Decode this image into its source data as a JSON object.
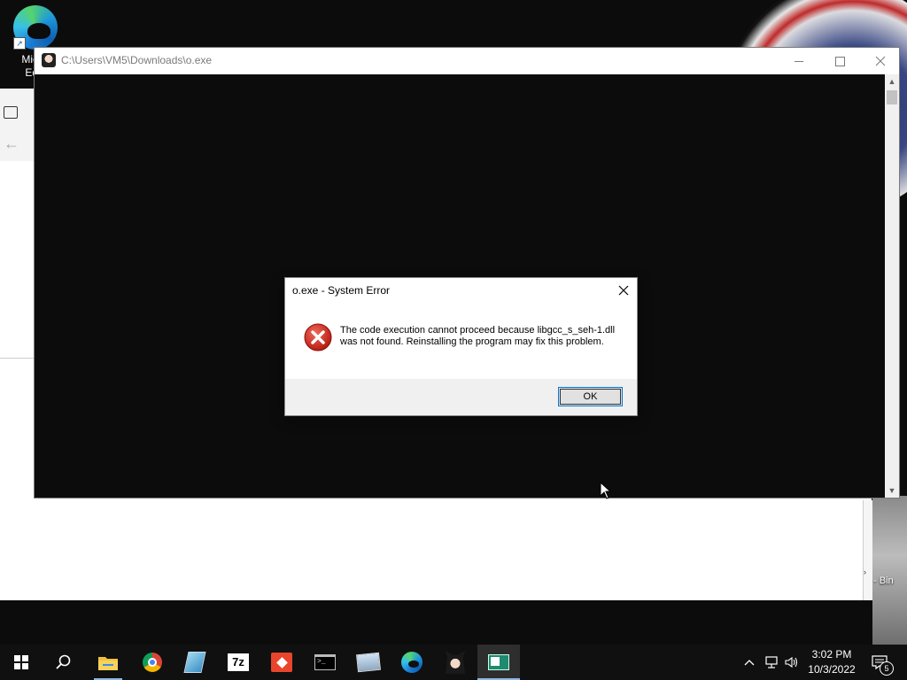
{
  "desktop": {
    "edge_icon_label": "Micro\nEdg",
    "recycle_label": "- Bin"
  },
  "console_window": {
    "title": "C:\\Users\\VM5\\Downloads\\o.exe",
    "minimize_label": "—",
    "maximize_label": "☐",
    "close_label": "✕"
  },
  "dialog": {
    "title": "o.exe - System Error",
    "message": "The code execution cannot proceed because libgcc_s_seh-1.dll was not found. Reinstalling the program may fix this problem.",
    "ok_label": "OK"
  },
  "taskbar": {
    "apps": [
      {
        "name": "start",
        "icon": "windows-icon"
      },
      {
        "name": "search",
        "icon": "search-icon"
      },
      {
        "name": "file-explorer",
        "icon": "folder-icon"
      },
      {
        "name": "chrome",
        "icon": "chrome-icon"
      },
      {
        "name": "notepad-like",
        "icon": "notebook-icon"
      },
      {
        "name": "7zip",
        "icon": "7z-icon",
        "text": "7z"
      },
      {
        "name": "git",
        "icon": "git-icon"
      },
      {
        "name": "terminal",
        "icon": "cmd-icon"
      },
      {
        "name": "image-viewer",
        "icon": "photo-icon"
      },
      {
        "name": "edge",
        "icon": "edge-icon"
      },
      {
        "name": "anime-app",
        "icon": "character-icon"
      },
      {
        "name": "o-exe-console",
        "icon": "console-window-icon"
      }
    ],
    "time": "3:02 PM",
    "date": "10/3/2022",
    "notification_count": "5"
  },
  "colors": {
    "taskbar_bg": "#101010",
    "console_bg": "#0c0c0c",
    "ok_border": "#0078d7",
    "error_red": "#c42b1c"
  }
}
